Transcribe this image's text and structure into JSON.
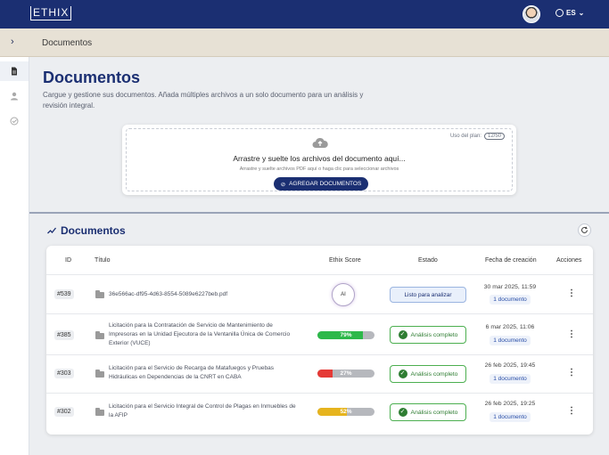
{
  "header": {
    "logo": "ETHIX",
    "language": "ES"
  },
  "breadcrumb": {
    "title": "Documentos"
  },
  "page": {
    "title": "Documentos",
    "subtitle": "Cargue y gestione sus documentos. Añada múltiples archivos a un solo documento para un análisis y revisión integral."
  },
  "upload": {
    "plan_label": "Uso del plan:",
    "plan_value": "12/50",
    "main_text": "Arrastre y suelte los archivos del documento aquí...",
    "hint_text": "Arrastre y suelte archivos PDF aquí o haga clic para seleccionar archivos",
    "button_label": "AGREGAR DOCUMENTOS"
  },
  "section": {
    "title": "Documentos"
  },
  "table": {
    "headers": {
      "id": "ID",
      "title": "Título",
      "score": "Ethix Score",
      "state": "Estado",
      "date": "Fecha de creación",
      "actions": "Acciones"
    },
    "rows": [
      {
        "id": "#539",
        "title": "36e566ac-df95-4d63-8554-5089e6227beb.pdf",
        "score_label": "AI",
        "score": null,
        "state": "Listo para analizar",
        "date": "30 mar 2025, 11:59",
        "docs": "1 documento"
      },
      {
        "id": "#385",
        "title": "Licitación para la Contratación de Servicio de Mantenimiento de Impresoras en la Unidad Ejecutora de la Ventanilla Única de Comercio Exterior (VUCE)",
        "score": 79,
        "score_label": "79%",
        "score_color": "#2db84a",
        "state": "Análisis completo",
        "date": "6 mar 2025, 11:06",
        "docs": "1 documento"
      },
      {
        "id": "#303",
        "title": "Licitación para el Servicio de Recarga de Matafuegos y Pruebas Hidráulicas en Dependencias de la CNRT en CABA",
        "score": 27,
        "score_label": "27%",
        "score_color": "#e53935",
        "state": "Análisis completo",
        "date": "26 feb 2025, 19:45",
        "docs": "1 documento"
      },
      {
        "id": "#302",
        "title": "Licitación para el Servicio Integral de Control de Plagas en Inmuebles de la AFIP",
        "score": 52,
        "score_label": "52%",
        "score_color": "#e6b41e",
        "state": "Análisis completo",
        "date": "26 feb 2025, 19:25",
        "docs": "1 documento"
      }
    ]
  },
  "colors": {
    "primary": "#1b2f72",
    "success": "#2e7d32"
  }
}
